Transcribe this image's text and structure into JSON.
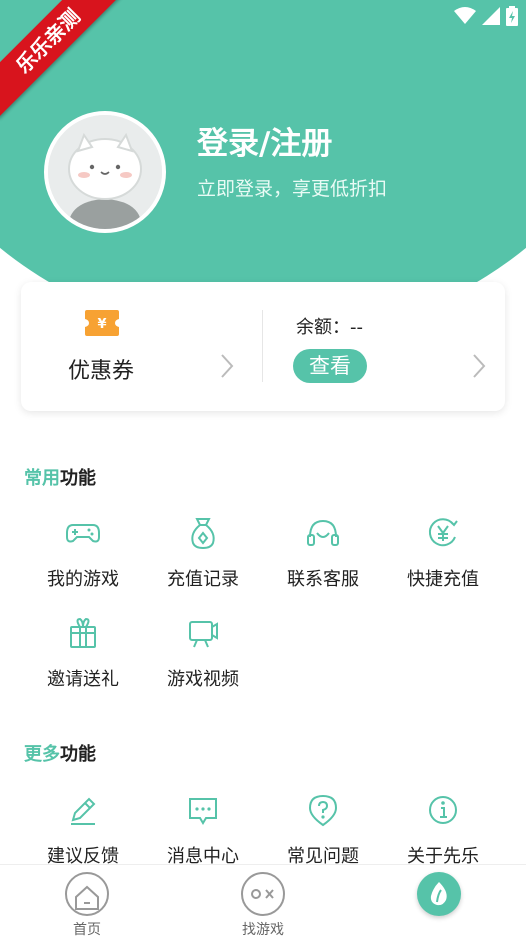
{
  "watermark": "乐乐亲测",
  "profile": {
    "login_title": "登录/注册",
    "login_subtitle": "立即登录，享更低折扣"
  },
  "wallet": {
    "coupon_label": "优惠券",
    "balance_label": "余额：--",
    "view_button": "查看"
  },
  "common_section": {
    "title_accent": "常用",
    "title_rest": "功能",
    "items": [
      {
        "label": "我的游戏",
        "icon": "gamepad-icon"
      },
      {
        "label": "充值记录",
        "icon": "money-bag-icon"
      },
      {
        "label": "联系客服",
        "icon": "headset-icon"
      },
      {
        "label": "快捷充值",
        "icon": "yen-coin-icon"
      },
      {
        "label": "邀请送礼",
        "icon": "gift-icon"
      },
      {
        "label": "游戏视频",
        "icon": "video-icon"
      }
    ]
  },
  "more_section": {
    "title_accent": "更多",
    "title_rest": "功能",
    "items": [
      {
        "label": "建议反馈",
        "icon": "pencil-icon"
      },
      {
        "label": "消息中心",
        "icon": "message-icon"
      },
      {
        "label": "常见问题",
        "icon": "question-icon"
      },
      {
        "label": "关于先乐",
        "icon": "info-icon"
      }
    ]
  },
  "tabbar": {
    "home": "首页",
    "find_games": "找游戏"
  },
  "colors": {
    "accent": "#56c3a9",
    "ribbon": "#d8141d"
  }
}
